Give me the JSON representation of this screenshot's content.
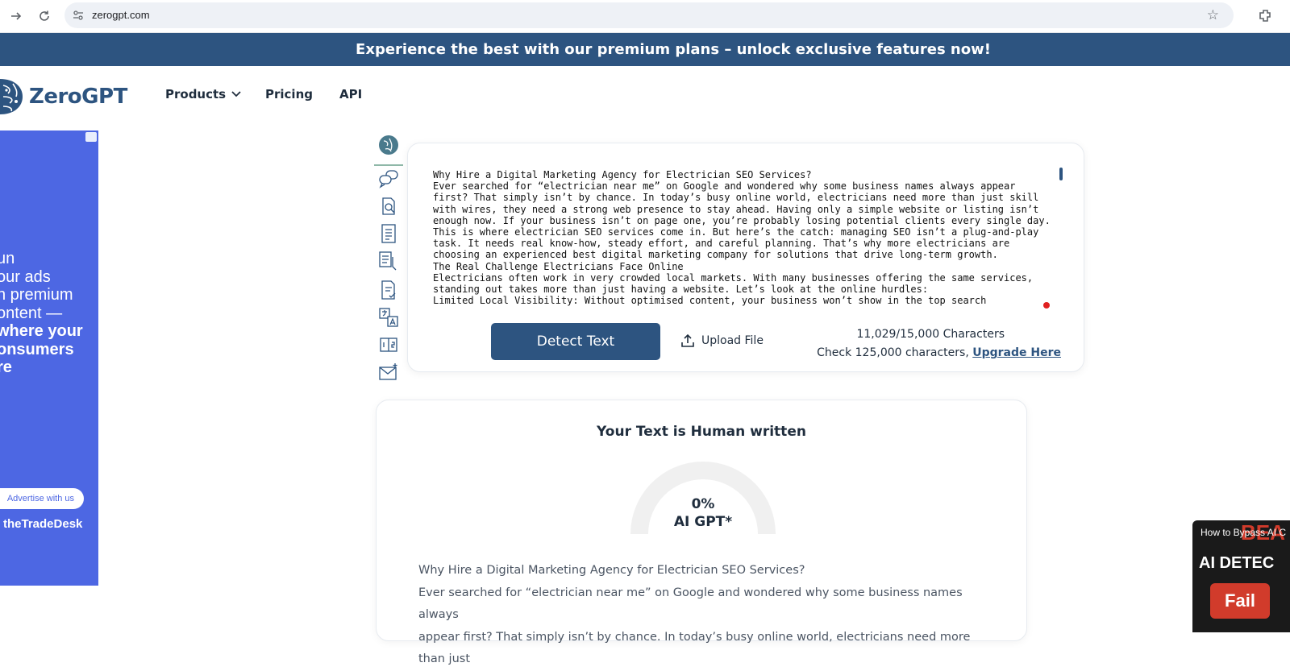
{
  "browser": {
    "url": "zerogpt.com"
  },
  "promo": {
    "text": "Experience the best with our premium plans – unlock exclusive features now!"
  },
  "header": {
    "brand": "ZeroGPT",
    "nav": [
      {
        "label": "Products"
      },
      {
        "label": "Pricing"
      },
      {
        "label": "API"
      }
    ]
  },
  "ad": {
    "headline_lines": [
      "un",
      "our ads",
      "n premium",
      "ontent —"
    ],
    "headline_bold_lines": [
      "where your",
      "onsumers",
      "re"
    ],
    "cta": "Advertise with us",
    "brand": "theTradeDesk"
  },
  "editor": {
    "text": "Why Hire a Digital Marketing Agency for Electrician SEO Services?\nEver searched for “electrician near me” on Google and wondered why some business names always appear first? That simply isn’t by chance. In today’s busy online world, electricians need more than just skill with wires, they need a strong web presence to stay ahead. Having only a simple website or listing isn’t enough now. If your business isn’t on page one, you’re probably losing potential clients every single day.\nThis is where electrician SEO services come in. But here’s the catch: managing SEO isn’t a plug-and-play task. It needs real know-how, steady effort, and careful planning. That’s why more electricians are choosing an experienced best digital marketing company for solutions that drive long-term growth.\nThe Real Challenge Electricians Face Online\nElectricians often work in very crowded local markets. With many businesses offering the same services, standing out takes more than just having a website. Let’s look at the online hurdles:\nLimited Local Visibility: Without optimised content, your business won’t show in the top search",
    "detect_label": "Detect Text",
    "upload_label": "Upload File",
    "char_count": "11,029/15,000 Characters",
    "check_text": "Check 125,000 characters, ",
    "upgrade_label": "Upgrade Here"
  },
  "result": {
    "verdict": "Your Text is Human written",
    "ai_percent": 0,
    "gauge_value": "0%",
    "gauge_label": "AI GPT*",
    "body_lines": [
      "Why Hire a Digital Marketing Agency for Electrician SEO Services?",
      "Ever searched for “electrician near me” on Google and wondered why some business names always",
      "appear first? That simply isn’t by chance. In today’s busy online world, electricians need more than just"
    ]
  },
  "video": {
    "title": "How to Bypass AI C",
    "overlay_top": "BEA",
    "overlay_mid": "AI DETEC",
    "button": "Fail"
  },
  "colors": {
    "brand": "#2d5480",
    "ad_bg": "#4d67e3",
    "gauge_track": "#f0f0f0"
  }
}
